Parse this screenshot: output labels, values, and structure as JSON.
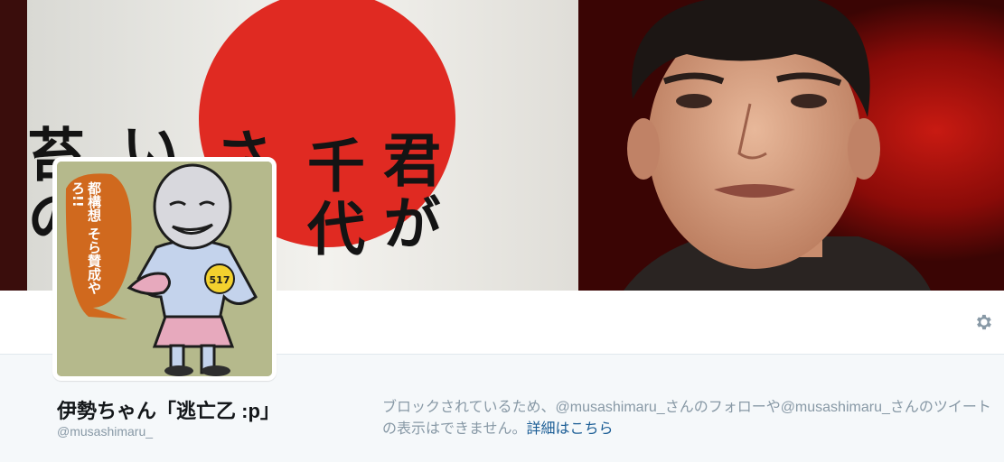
{
  "banner": {
    "text_columns": [
      "君が",
      "千代",
      "さ",
      "い",
      "苔の"
    ]
  },
  "profile": {
    "name": "伊勢ちゃん「逃亡乙 :p」",
    "handle": "@musashimaru_"
  },
  "avatar": {
    "speech_bubble": "都構想 そら賛成やろ!!",
    "badge": "517"
  },
  "blocked_notice": {
    "message": "ブロックされているため、@musashimaru_さんのフォローや@musashimaru_さんのツイートの表示はできません。",
    "link_label": "詳細はこちら"
  },
  "icons": {
    "settings": "gear-icon"
  },
  "colors": {
    "link": "#1b5d95",
    "muted": "#8899a6",
    "name": "#14171a",
    "background": "#f5f8fa"
  }
}
